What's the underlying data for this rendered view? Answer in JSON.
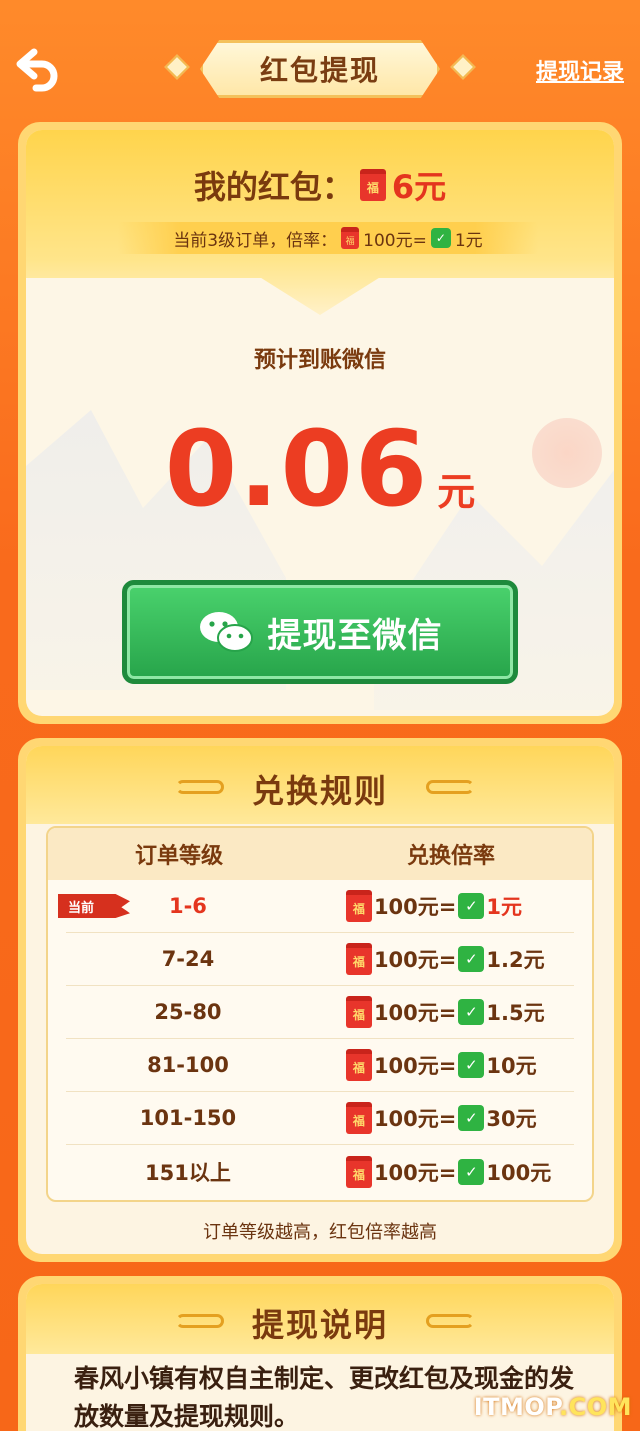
{
  "header": {
    "title": "红包提现",
    "records_link": "提现记录"
  },
  "balance": {
    "label": "我的红包：",
    "amount": "6元"
  },
  "rate_banner": {
    "prefix": "当前3级订单，倍率：",
    "left_value": "100元=",
    "right_value": "1元"
  },
  "expected": {
    "label": "预计到账微信",
    "amount": "0.06",
    "unit": "元"
  },
  "withdraw_button": {
    "label": "提现至微信"
  },
  "rules": {
    "title": "兑换规则",
    "col_level": "订单等级",
    "col_rate": "兑换倍率",
    "current_tag": "当前",
    "rows": [
      {
        "level": "1-6",
        "left": "100元=",
        "right": "1元"
      },
      {
        "level": "7-24",
        "left": "100元=",
        "right": "1.2元"
      },
      {
        "level": "25-80",
        "left": "100元=",
        "right": "1.5元"
      },
      {
        "level": "81-100",
        "left": "100元=",
        "right": "10元"
      },
      {
        "level": "101-150",
        "left": "100元=",
        "right": "30元"
      },
      {
        "level": "151以上",
        "left": "100元=",
        "right": "100元"
      }
    ],
    "note": "订单等级越高，红包倍率越高"
  },
  "instructions": {
    "title": "提现说明",
    "text": "春风小镇有权自主制定、更改红包及现金的发放数量及提现规则。"
  },
  "watermark": {
    "brand": "ITMOP",
    "suffix": ".COM"
  },
  "icons": {
    "redpacket_glyph": "福",
    "wechat_glyph": "✓"
  },
  "colors": {
    "background": "#f96a1c",
    "gold": "#ffd773",
    "accent_red": "#ec3d22",
    "wechat_green": "#2fb342"
  }
}
